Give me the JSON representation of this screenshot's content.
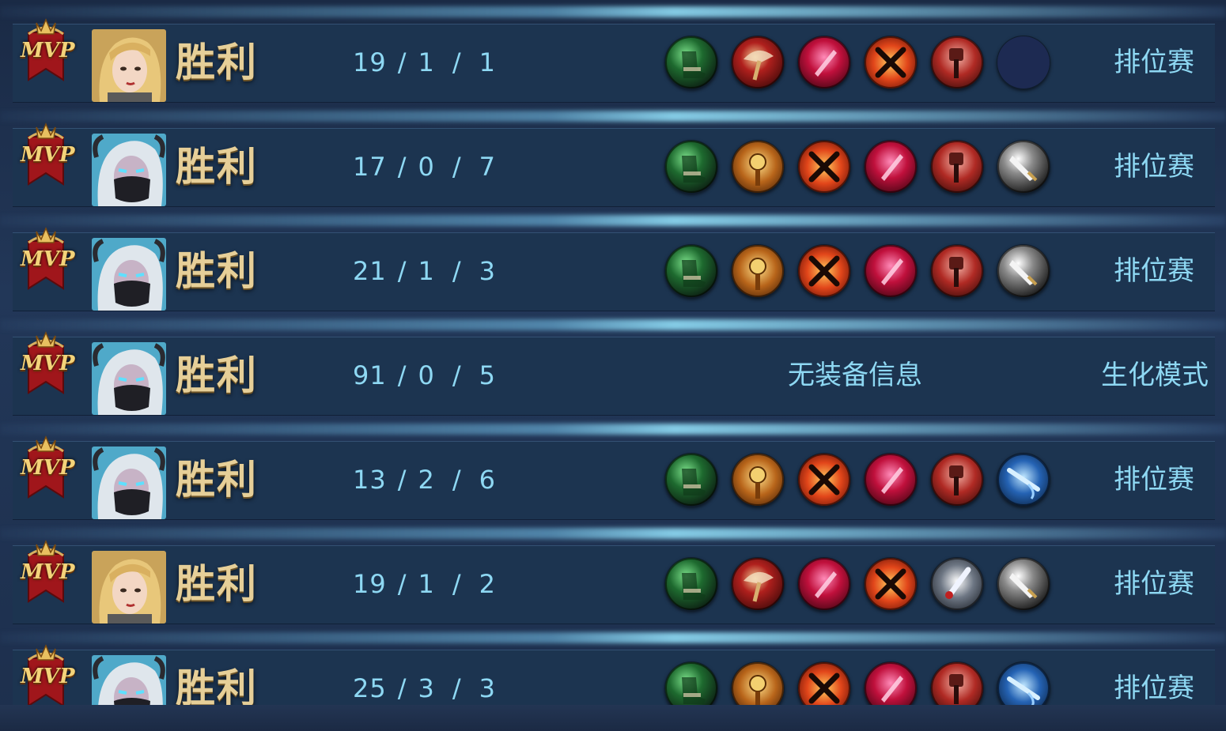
{
  "colors": {
    "row_bg": "#1c3450",
    "text_cyan": "#8ed8f3",
    "victory_gold": "#e6cf98",
    "mvp_red": "#a0161b"
  },
  "rows": [
    {
      "mvp": "MVP",
      "hero": "blonde-hero",
      "result": "胜利",
      "kills": "19",
      "deaths": "1",
      "assists": "1",
      "items": [
        "green-boots",
        "red-axe",
        "pink-blade",
        "red-crossed-swords",
        "red-hammer",
        "empty-slot"
      ],
      "equipment_text": "",
      "mode": "排位赛"
    },
    {
      "mvp": "MVP",
      "hero": "masked-hero",
      "result": "胜利",
      "kills": "17",
      "deaths": "0",
      "assists": "7",
      "items": [
        "green-boots",
        "gold-mace",
        "red-crossed-swords",
        "pink-blade",
        "red-hammer",
        "white-greatsword"
      ],
      "equipment_text": "",
      "mode": "排位赛"
    },
    {
      "mvp": "MVP",
      "hero": "masked-hero",
      "result": "胜利",
      "kills": "21",
      "deaths": "1",
      "assists": "3",
      "items": [
        "green-boots",
        "gold-mace",
        "red-crossed-swords",
        "pink-blade",
        "red-hammer",
        "white-greatsword"
      ],
      "equipment_text": "",
      "mode": "排位赛"
    },
    {
      "mvp": "MVP",
      "hero": "masked-hero",
      "result": "胜利",
      "kills": "91",
      "deaths": "0",
      "assists": "5",
      "items": [],
      "equipment_text": "无装备信息",
      "mode": "生化模式"
    },
    {
      "mvp": "MVP",
      "hero": "masked-hero",
      "result": "胜利",
      "kills": "13",
      "deaths": "2",
      "assists": "6",
      "items": [
        "green-boots",
        "gold-mace",
        "red-crossed-swords",
        "pink-blade",
        "red-hammer",
        "blue-lance"
      ],
      "equipment_text": "",
      "mode": "排位赛"
    },
    {
      "mvp": "MVP",
      "hero": "blonde-hero",
      "result": "胜利",
      "kills": "19",
      "deaths": "1",
      "assists": "2",
      "items": [
        "green-boots",
        "red-axe",
        "pink-blade",
        "red-crossed-swords",
        "silver-sword",
        "white-greatsword"
      ],
      "equipment_text": "",
      "mode": "排位赛"
    },
    {
      "mvp": "MVP",
      "hero": "masked-hero",
      "result": "胜利",
      "kills": "25",
      "deaths": "3",
      "assists": "3",
      "items": [
        "green-boots",
        "gold-mace",
        "red-crossed-swords",
        "pink-blade",
        "red-hammer",
        "blue-lance"
      ],
      "equipment_text": "",
      "mode": "排位赛"
    }
  ]
}
